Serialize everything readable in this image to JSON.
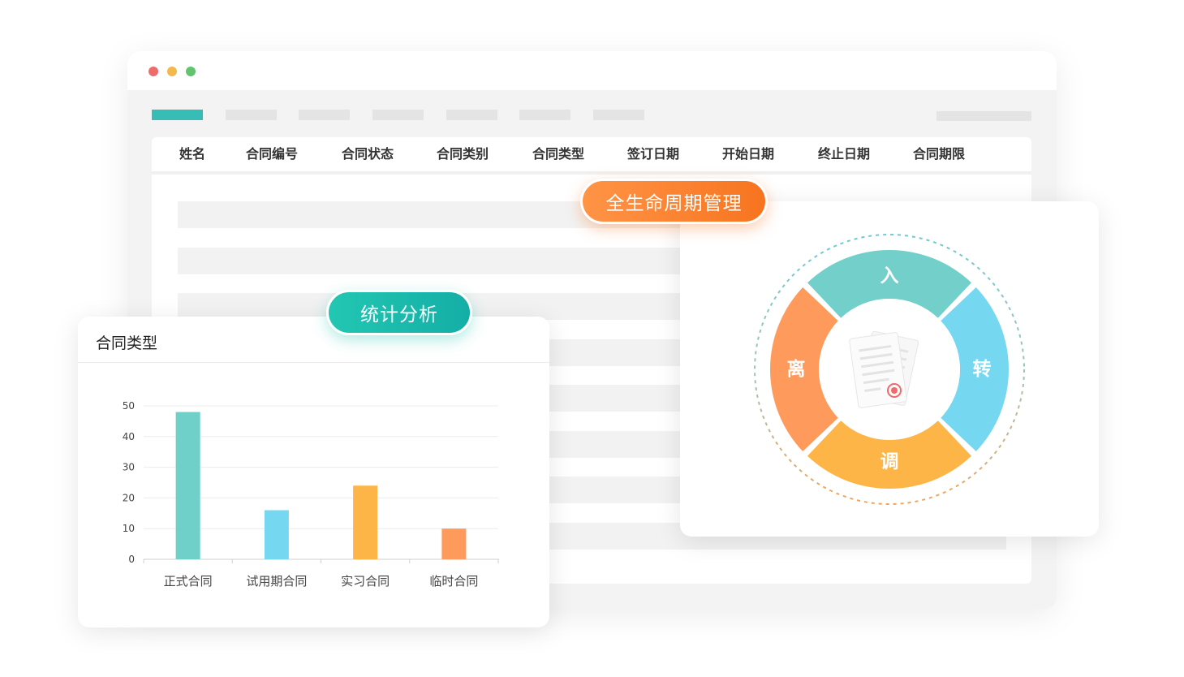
{
  "table": {
    "columns": [
      "姓名",
      "合同编号",
      "合同状态",
      "合同类别",
      "合同类型",
      "签订日期",
      "开始日期",
      "终止日期",
      "合同期限"
    ]
  },
  "badges": {
    "stats": "统计分析",
    "lifecycle": "全生命周期管理"
  },
  "chart_data": {
    "type": "bar",
    "title": "合同类型",
    "categories": [
      "正式合同",
      "试用期合同",
      "实习合同",
      "临时合同"
    ],
    "values": [
      48,
      16,
      24,
      10
    ],
    "colors": [
      "#6fcfc9",
      "#76d8f0",
      "#fdb547",
      "#fe9a5c"
    ],
    "ylim": [
      0,
      50
    ],
    "yticks": [
      0,
      10,
      20,
      30,
      40,
      50
    ],
    "grid": true
  },
  "lifecycle": {
    "segments": [
      {
        "label": "入",
        "color": "#72cfc9"
      },
      {
        "label": "转",
        "color": "#76d8f0"
      },
      {
        "label": "调",
        "color": "#fdb547"
      },
      {
        "label": "离",
        "color": "#fe9a5c"
      }
    ],
    "seal_color": "#f06a6a"
  },
  "window": {
    "dot_colors": [
      "#ef6b6b",
      "#f3b94d",
      "#62c370"
    ],
    "accent": "#38bdb6"
  }
}
